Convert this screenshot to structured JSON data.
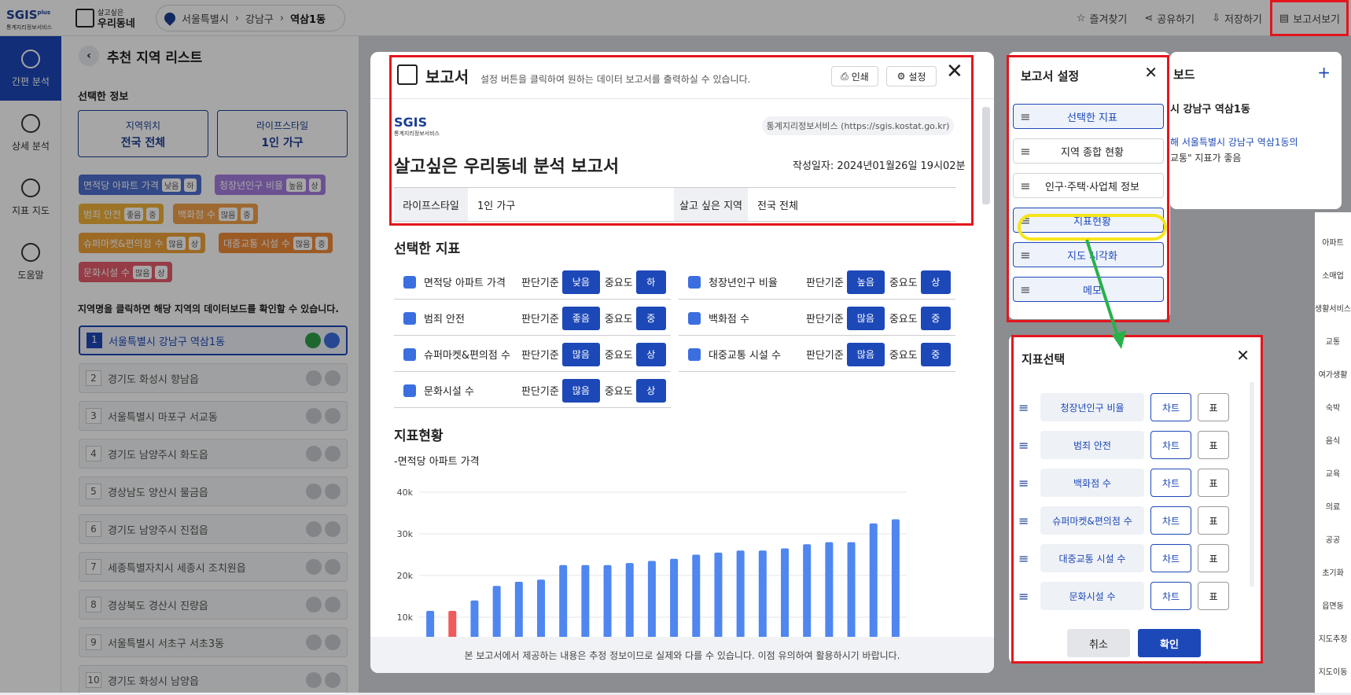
{
  "header": {
    "logo": "SGIS",
    "logo_plus": "plus",
    "logo_sub": "통계지리정보서비스",
    "app_top": "살고싶은",
    "app_bottom": "우리동네",
    "breadcrumb": [
      "서울특별시",
      "강남구",
      "역삼1동"
    ],
    "links": [
      "즐겨찾기",
      "공유하기",
      "저장하기",
      "보고서보기"
    ]
  },
  "nav": [
    "간편 분석",
    "상세 분석",
    "지표 지도",
    "도움말"
  ],
  "side": {
    "title": "추천 지역 리스트",
    "selected_label": "선택한 정보",
    "sel1_label": "지역위치",
    "sel1_value": "전국 전체",
    "sel2_label": "라이프스타일",
    "sel2_value": "1인 가구",
    "tags": [
      {
        "text": "면적당 아파트 가격",
        "a": "낮음",
        "b": "하",
        "color": "#4d6fd0"
      },
      {
        "text": "청장년인구 비율",
        "a": "높음",
        "b": "상",
        "color": "#a77de0"
      },
      {
        "text": "범죄 안전",
        "a": "좋음",
        "b": "중",
        "color": "#f1b23a"
      },
      {
        "text": "백화점 수",
        "a": "많음",
        "b": "중",
        "color": "#f3a24a"
      },
      {
        "text": "슈퍼마켓&편의점 수",
        "a": "많음",
        "b": "상",
        "color": "#f0a33a"
      },
      {
        "text": "대중교통 시설 수",
        "a": "많음",
        "b": "중",
        "color": "#f08c3a"
      },
      {
        "text": "문화시설 수",
        "a": "많음",
        "b": "상",
        "color": "#e65c6c"
      }
    ],
    "hint": "지역명을 클릭하면 해당 지역의 데이터보드를 확인할 수 있습니다.",
    "regions": [
      "서울특별시 강남구 역삼1동",
      "경기도 화성시 향남읍",
      "서울특별시 마포구 서교동",
      "경기도 남양주시 화도읍",
      "경상남도 양산시 물금읍",
      "경기도 남양주시 진접읍",
      "세종특별자치시 세종시 조치원읍",
      "경상북도 경산시 진량읍",
      "서울특별시 서초구 서초3동",
      "경기도 화성시 남양읍"
    ]
  },
  "report": {
    "title": "보고서",
    "desc": "설정 버튼을 클릭하여 원하는 데이터 보고서를 출력하실 수 있습니다.",
    "print": "인쇄",
    "settings": "설정",
    "site": "통계지리정보서비스 (https://sgis.kostat.go.kr)",
    "main_title": "살고싶은 우리동네 분석 보고서",
    "date": "작성일자: 2024년01월26일 19시02분",
    "th1": "라이프스타일",
    "td1": "1인 가구",
    "th2": "살고 싶은 지역",
    "td2": "전국 전체",
    "sec1": "선택한 지표",
    "crit": "판단기준",
    "imp": "중요도",
    "indicators": [
      {
        "name": "면적당 아파트 가격",
        "c": "낮음",
        "i": "하"
      },
      {
        "name": "청장년인구 비율",
        "c": "높음",
        "i": "상"
      },
      {
        "name": "범죄 안전",
        "c": "좋음",
        "i": "중"
      },
      {
        "name": "백화점 수",
        "c": "많음",
        "i": "중"
      },
      {
        "name": "슈퍼마켓&편의점 수",
        "c": "많음",
        "i": "상"
      },
      {
        "name": "대중교통 시설 수",
        "c": "많음",
        "i": "중"
      },
      {
        "name": "문화시설 수",
        "c": "많음",
        "i": "상"
      }
    ],
    "sec2": "지표현황",
    "chart_sub": "-면적당 아파트 가격",
    "footer": "본 보고서에서 제공하는 내용은 추정 정보이므로 실제와 다를 수 있습니다. 이점 유의하여 활용하시기 바랍니다."
  },
  "chart_data": {
    "type": "bar",
    "title": "",
    "ylabels": [
      "40k",
      "30k",
      "20k",
      "10k"
    ],
    "ylim": [
      0,
      40000
    ],
    "values": [
      11500,
      11500,
      14000,
      17500,
      18500,
      19000,
      22500,
      22500,
      22500,
      23000,
      23500,
      24000,
      25000,
      25500,
      26000,
      26000,
      26500,
      27500,
      28000,
      28000,
      32500,
      33500
    ],
    "highlight_index": 1,
    "colors": {
      "bar": "#4f86f0",
      "highlight": "#f05a5a"
    }
  },
  "settings_panel": {
    "title": "보고서 설정",
    "items": [
      "선택한 지표",
      "지역 종합 현황",
      "인구·주택·사업체 정보",
      "지표현황",
      "지도 시각화",
      "메모"
    ]
  },
  "indicator_select": {
    "title": "지표선택",
    "rows": [
      "청장년인구 비율",
      "범죄 안전",
      "백화점 수",
      "슈퍼마켓&편의점 수",
      "대중교통 시설 수",
      "문화시설 수"
    ],
    "chart": "차트",
    "table": "표",
    "cancel": "취소",
    "ok": "확인"
  },
  "dashboard": {
    "title": "보드",
    "region": "시 강남구 역삼1동",
    "text1": "해 서울특별시 강남구 역삼1동의",
    "text2": "교통\" 지표가 좋음"
  },
  "rightbar": [
    "아파트",
    "소매업",
    "생활서비스",
    "교통",
    "여가생활",
    "숙박",
    "음식",
    "교육",
    "의료",
    "공공",
    "초기화",
    "읍면동",
    "지도추정",
    "지도이동"
  ]
}
